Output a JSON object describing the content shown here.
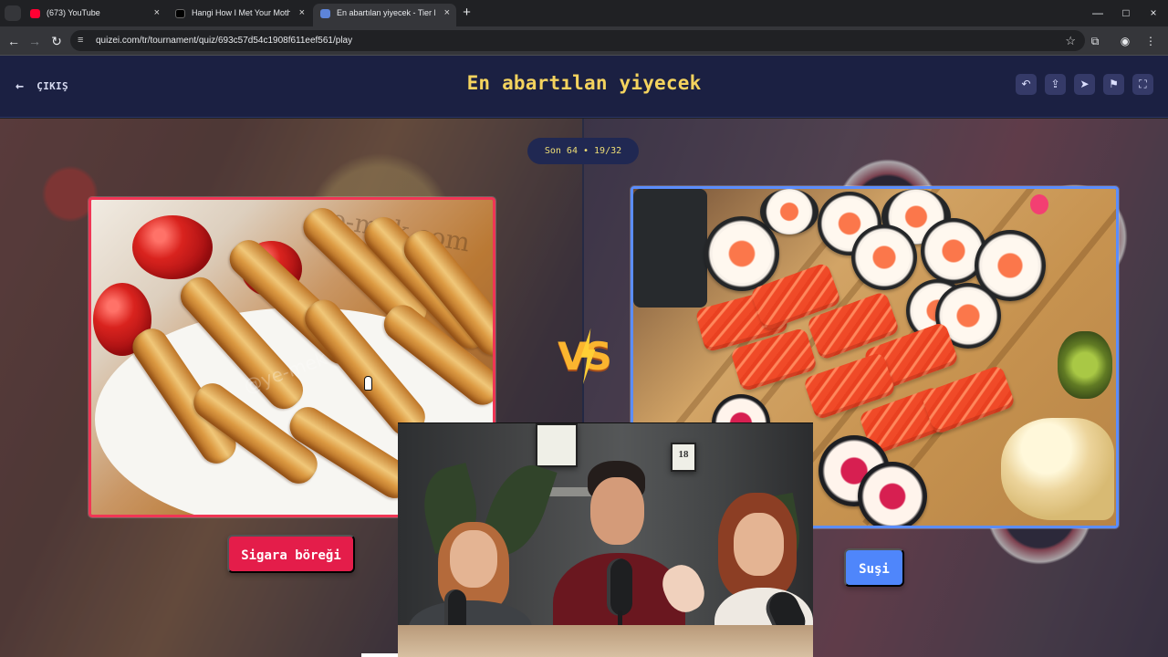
{
  "browser": {
    "tab_menu_icon": "chevron-down-icon",
    "tabs": [
      {
        "label": "(673) YouTube",
        "close": "×",
        "icon": "youtube-icon",
        "icon_color": "#ff0033"
      },
      {
        "label": "Hangi How I Met Your Mother",
        "close": "×",
        "icon": "circle-icon",
        "icon_color": "#000000"
      },
      {
        "label": "En abartılan yiyecek - Tier List,",
        "close": "×",
        "icon": "quizei-icon",
        "icon_color": "#5d84d8"
      }
    ],
    "new_tab": "+",
    "window_controls": [
      "—",
      "□",
      "×"
    ],
    "url": "quizei.com/tr/tournament/quiz/693c57d54c1908f611eef561/play",
    "nav_icons": [
      "back-arrow-icon",
      "forward-arrow-icon",
      "reload-icon",
      "site-settings-icon",
      "star-icon",
      "extensions-icon",
      "profile-icon",
      "menu-dots-icon"
    ]
  },
  "header": {
    "exit_label": "ÇIKIŞ",
    "exit_icon": "left-arrow-icon",
    "title": "En abartılan yiyecek",
    "action_icons": [
      "undo-icon",
      "share-icon",
      "send-icon",
      "flag-icon",
      "fullscreen-icon"
    ]
  },
  "tournament": {
    "round_badge": "Son 64 • 19/32",
    "vs_text": "VS",
    "left_choice": {
      "label": "Sigara böreği",
      "image_watermark": "ye-mek.com",
      "image_watermark2": "@ye-mek"
    },
    "right_choice": {
      "label": "Suşi"
    }
  },
  "overlay": {
    "frame_text": "18"
  },
  "colors": {
    "header_bg": "#1b2042",
    "title": "#f4d35e",
    "left_accent": "#f03655",
    "right_accent": "#5b8dfd",
    "round_badge": "#202852"
  }
}
